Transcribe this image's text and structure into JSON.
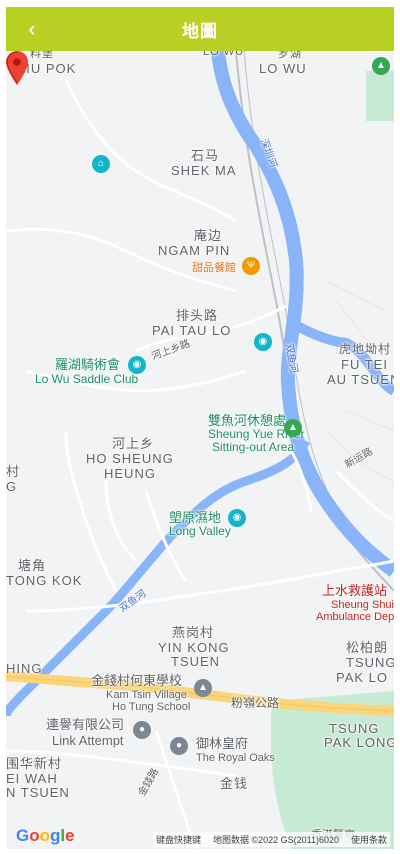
{
  "header": {
    "title": "地圖",
    "back_icon": "back-arrow-icon",
    "bg_color": "#b8cf24"
  },
  "map": {
    "places": [
      {
        "id": "lowu-top",
        "text": "LO WU"
      },
      {
        "id": "liupok-cn",
        "text": "料堡"
      },
      {
        "id": "liupok",
        "text": "LIU POK"
      },
      {
        "id": "lowu-cn",
        "text": "罗湖"
      },
      {
        "id": "lowu",
        "text": "LO WU"
      },
      {
        "id": "shekma-cn",
        "text": "石马"
      },
      {
        "id": "shekma",
        "text": "SHEK MA"
      },
      {
        "id": "ngampin-cn",
        "text": "庵边"
      },
      {
        "id": "ngampin",
        "text": "NGAM PIN"
      },
      {
        "id": "paitaulo-cn",
        "text": "排头路"
      },
      {
        "id": "paitaulo",
        "text": "PAI TAU LO"
      },
      {
        "id": "futei-cn",
        "text": "虎地坳村"
      },
      {
        "id": "futei",
        "text": "FU TEI"
      },
      {
        "id": "autsuen",
        "text": "AU TSUEN"
      },
      {
        "id": "hoseung-cn",
        "text": "河上乡"
      },
      {
        "id": "hoseung1",
        "text": "HO SHEUNG"
      },
      {
        "id": "hoseung2",
        "text": "HEUNG"
      },
      {
        "id": "tongkok-cn",
        "text": "塘角"
      },
      {
        "id": "tongkok",
        "text": "TONG KOK"
      },
      {
        "id": "yinkong-cn",
        "text": "燕岗村"
      },
      {
        "id": "yinkong1",
        "text": "YIN KONG"
      },
      {
        "id": "yinkong2",
        "text": "TSUEN"
      },
      {
        "id": "tsungpak-cn",
        "text": "松柏朗"
      },
      {
        "id": "tsungpak1",
        "text": "TSUNG"
      },
      {
        "id": "tsungpak2",
        "text": "PAK LO"
      },
      {
        "id": "tsungpak3",
        "text": "TSUNG"
      },
      {
        "id": "tsungpak4",
        "text": "PAK LONG"
      },
      {
        "id": "waihing-cn",
        "text": "围华新村"
      },
      {
        "id": "waihing1",
        "text": "EI WAH"
      },
      {
        "id": "waihing2",
        "text": "N TSUEN"
      },
      {
        "id": "kamtsin",
        "text": "金钱"
      },
      {
        "id": "hing",
        "text": "HING"
      }
    ],
    "pois": [
      {
        "id": "dessert",
        "text": "甜品餐館"
      },
      {
        "id": "saddle-cn",
        "text": "羅湖騎術會"
      },
      {
        "id": "saddle",
        "text": "Lo Wu Saddle Club"
      },
      {
        "id": "rest-cn",
        "text": "雙魚河休憩處"
      },
      {
        "id": "rest1",
        "text": "Sheung Yue River"
      },
      {
        "id": "rest2",
        "text": "Sitting-out Area"
      },
      {
        "id": "longvalley-cn",
        "text": "塱原濕地"
      },
      {
        "id": "longvalley",
        "text": "Long Valley"
      },
      {
        "id": "ambulance-cn",
        "text": "上水救護站"
      },
      {
        "id": "ambulance1",
        "text": "Sheung Shui"
      },
      {
        "id": "ambulance2",
        "text": "Ambulance Depot"
      },
      {
        "id": "school-cn",
        "text": "金錢村何東學校"
      },
      {
        "id": "school1",
        "text": "Kam Tsin Village"
      },
      {
        "id": "school2",
        "text": "Ho Tung School"
      },
      {
        "id": "link-cn",
        "text": "連譽有限公司"
      },
      {
        "id": "link",
        "text": "Link Attempt"
      },
      {
        "id": "royal-cn",
        "text": "御林皇府"
      },
      {
        "id": "royal",
        "text": "The Royal Oaks"
      },
      {
        "id": "police",
        "text": "香港警察..."
      }
    ],
    "roads": [
      {
        "id": "river-shenzhen",
        "text": "深圳河"
      },
      {
        "id": "river-sheungyue",
        "text": "双鱼河"
      },
      {
        "id": "river-sheungyue2",
        "text": "双鱼河"
      },
      {
        "id": "road-hoseung",
        "text": "河上乡路"
      },
      {
        "id": "road-fanling",
        "text": "粉嶺公路"
      },
      {
        "id": "road-san-wai",
        "text": "新运路"
      },
      {
        "id": "road-kamtsin",
        "text": "金錢路"
      }
    ],
    "footer": {
      "logo": "Google",
      "shortcuts": "键盘快捷键",
      "data": "地图数据 ©2022 GS(2011)6020",
      "terms": "使用条款"
    }
  }
}
